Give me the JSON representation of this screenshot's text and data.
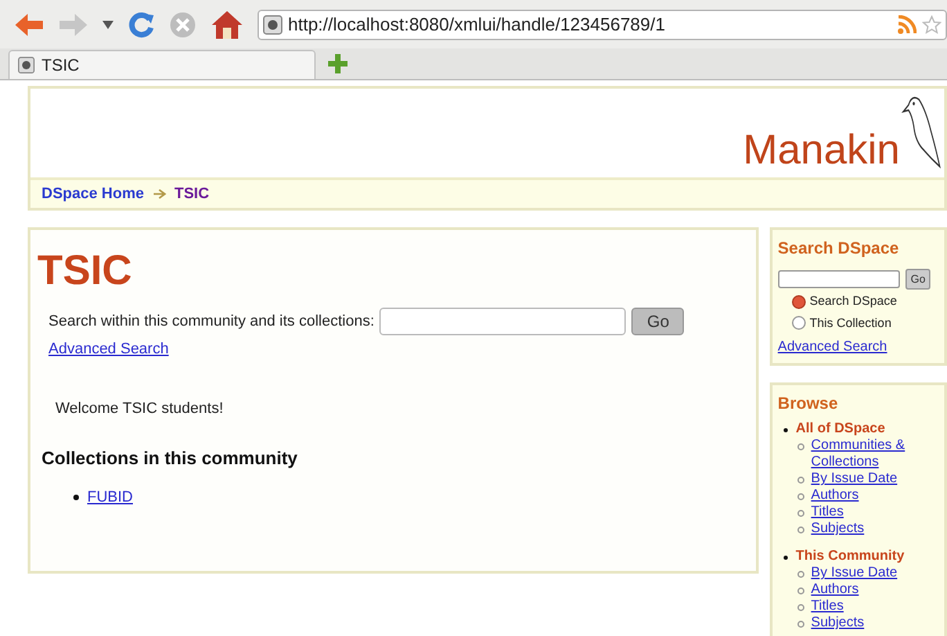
{
  "browser": {
    "url": "http://localhost:8080/xmlui/handle/123456789/1",
    "tabs": [
      {
        "title": "TSIC",
        "selected": true
      }
    ]
  },
  "header": {
    "logo_text": "Manakin"
  },
  "breadcrumbs": [
    {
      "label": "DSpace Home",
      "current": false
    },
    {
      "label": "TSIC",
      "current": true
    }
  ],
  "main": {
    "title": "TSIC",
    "search_label": "Search within this community and its collections:",
    "search_button": "Go",
    "advanced_search": "Advanced Search",
    "welcome": "Welcome TSIC students!",
    "collections_heading": "Collections in this community",
    "collections": [
      "FUBID"
    ]
  },
  "sidebar": {
    "search": {
      "title": "Search DSpace",
      "button": "Go",
      "scopes": [
        {
          "label": "Search DSpace",
          "selected": true
        },
        {
          "label": "This Collection",
          "selected": false
        }
      ],
      "advanced_search": "Advanced Search"
    },
    "browse": {
      "title": "Browse",
      "sections": [
        {
          "label": "All of DSpace",
          "links": [
            "Communities & Collections",
            "By Issue Date",
            "Authors",
            "Titles",
            "Subjects"
          ]
        },
        {
          "label": "This Community",
          "links": [
            "By Issue Date",
            "Authors",
            "Titles",
            "Subjects"
          ]
        }
      ]
    }
  }
}
